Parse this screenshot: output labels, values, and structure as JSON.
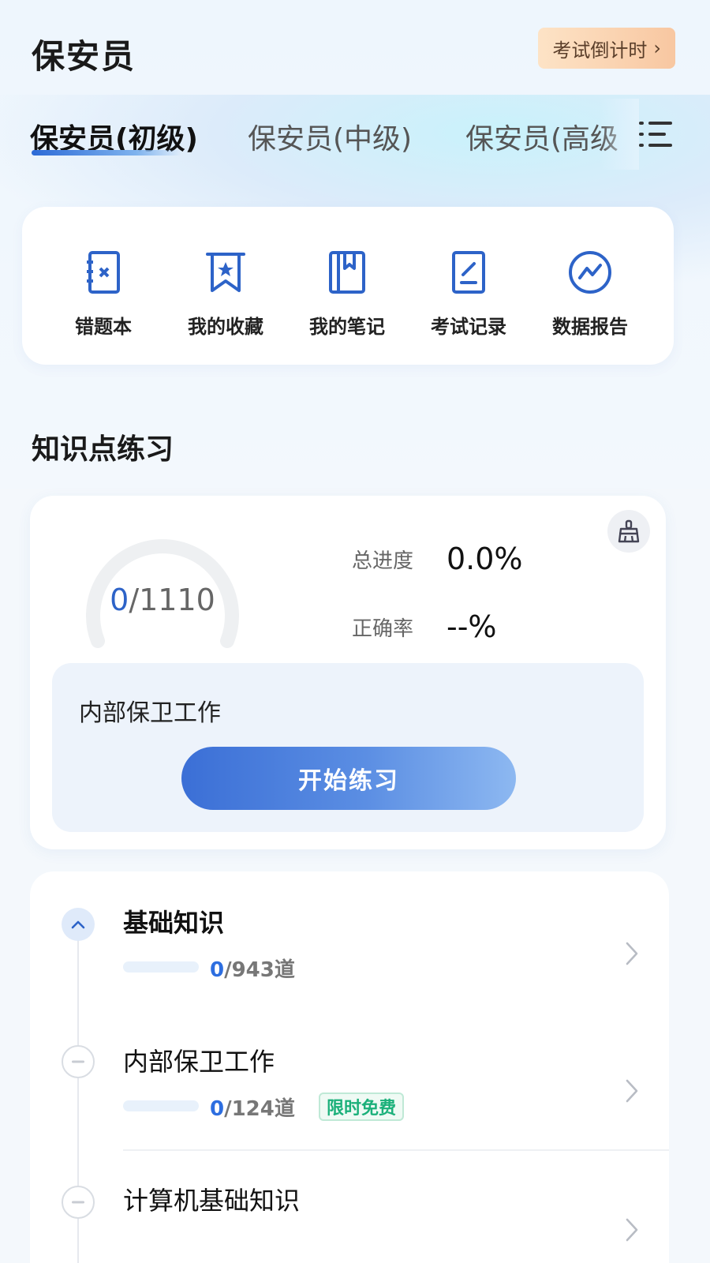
{
  "header": {
    "title": "保安员",
    "countdown_label": "考试倒计时",
    "countdown_chevron": "›"
  },
  "tabs": [
    {
      "label": "保安员(初级)",
      "active": true
    },
    {
      "label": "保安员(中级)",
      "active": false
    },
    {
      "label": "保安员(高级",
      "active": false
    }
  ],
  "quick_entries": [
    {
      "label": "错题本",
      "icon": "wrong-book-icon"
    },
    {
      "label": "我的收藏",
      "icon": "bookmark-icon"
    },
    {
      "label": "我的笔记",
      "icon": "notebook-icon"
    },
    {
      "label": "考试记录",
      "icon": "exam-record-icon"
    },
    {
      "label": "数据报告",
      "icon": "data-report-icon"
    }
  ],
  "section": {
    "title": "知识点练习"
  },
  "progress": {
    "done": "0",
    "total": "/1110",
    "total_progress_label": "总进度",
    "total_progress_value": "0.0%",
    "accuracy_label": "正确率",
    "accuracy_value": "--%",
    "gauge_fraction": 0
  },
  "current": {
    "name": "内部保卫工作",
    "start_label": "开始练习"
  },
  "chapters": [
    {
      "title": "基础知识",
      "done": "0",
      "total": "/943道",
      "expanded": true
    },
    {
      "title": "内部保卫工作",
      "done": "0",
      "total": "/124道",
      "badge": "限时免费"
    },
    {
      "title": "计算机基础知识"
    }
  ],
  "colors": {
    "primary": "#2d63c8",
    "accent_orange": "#f8c7a1",
    "free_green": "#1bb07a"
  }
}
